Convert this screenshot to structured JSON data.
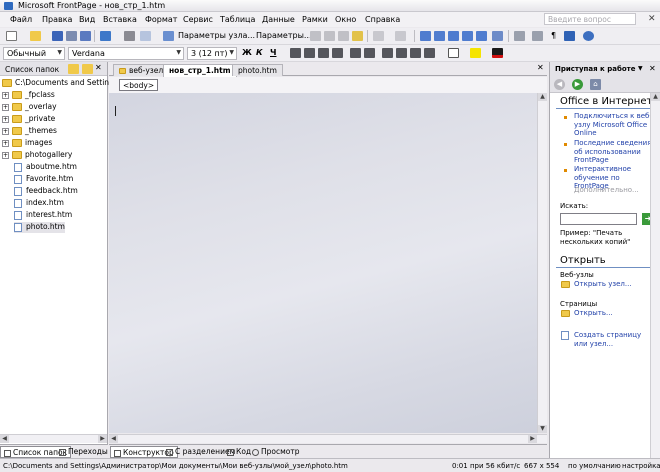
{
  "window": {
    "title": "Microsoft FrontPage - нов_стр_1.htm"
  },
  "menu": {
    "items": [
      "Файл",
      "Правка",
      "Вид",
      "Вставка",
      "Формат",
      "Сервис",
      "Таблица",
      "Данные",
      "Рамки",
      "Окно",
      "Справка"
    ],
    "help_placeholder": "Введите вопрос"
  },
  "toolbar": {
    "site_params": "Параметры узла...",
    "params": "Параметры..."
  },
  "format": {
    "style": "Обычный",
    "font": "Verdana",
    "size": "3  (12 пт)",
    "bold": "Ж",
    "italic": "К",
    "underline": "Ч"
  },
  "folder_list": {
    "title": "Список папок",
    "root": "C:\\Documents and Settings\\A",
    "folders": [
      "_fpclass",
      "_overlay",
      "_private",
      "_themes",
      "images",
      "photogallery"
    ],
    "files": [
      "aboutme.htm",
      "Favorite.htm",
      "feedback.htm",
      "index.htm",
      "interest.htm",
      "photo.htm"
    ]
  },
  "bottom_left_tabs": [
    "Список папок",
    "Переходы"
  ],
  "doc_tabs": [
    "веб-узел",
    "нов_стр_1.htm",
    "photo.htm"
  ],
  "quick_tag": "<body>",
  "view_tabs": [
    "Конструктор",
    "С разделением",
    "Код",
    "Просмотр"
  ],
  "task_pane": {
    "title": "Приступая к работе",
    "office_heading": "Office в Интернете",
    "links": [
      "Подключиться к веб-узлу Microsoft Office Online",
      "Последние сведения об использовании FrontPage",
      "Интерактивное обучение по FrontPage"
    ],
    "more": "Дополнительно...",
    "search_label": "Искать:",
    "example": "Пример: \"Печать нескольких копий\"",
    "open_heading": "Открыть",
    "websites_label": "Веб-узлы",
    "open_site": "Открыть узел...",
    "pages_label": "Страницы",
    "open_page": "Открыть...",
    "create": "Создать страницу или узел..."
  },
  "status": {
    "path": "C:\\Documents and Settings\\Администратор\\Мои документы\\Мои веб-узлы\\мой_узел\\photo.htm",
    "time": "0:01 при 56 кбит/с",
    "dims": "667 x 554",
    "default": "по умолчанию",
    "custom": "настройка"
  }
}
